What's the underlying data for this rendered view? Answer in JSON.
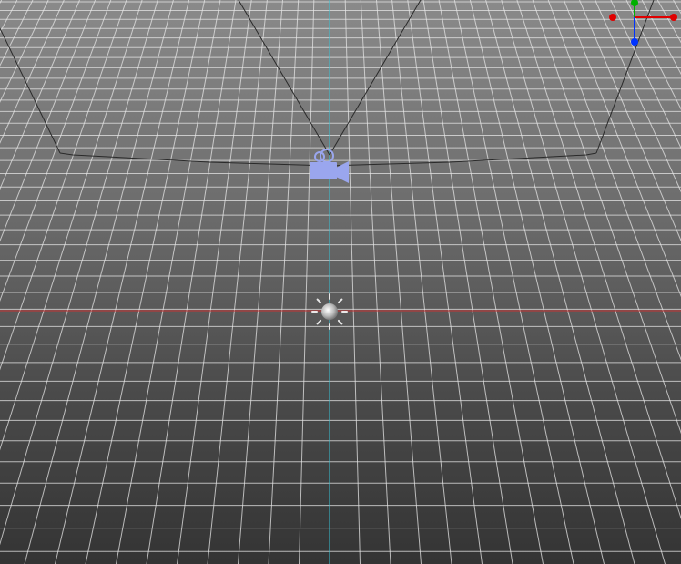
{
  "viewport": {
    "type": "3d-perspective-viewport",
    "background_top": "#8a8a8a",
    "background_bottom": "#343434",
    "grid_color": "#e6e6e6",
    "x_axis_color": "#c83232",
    "z_axis_color": "#36c3d6"
  },
  "objects": {
    "camera": {
      "icon": "video-camera-icon",
      "color": "#9aa6ee"
    },
    "light": {
      "icon": "sun-light-icon",
      "color": "#e8e8e8"
    },
    "frustum": {
      "color": "#2a2a2a"
    }
  },
  "gizmo": {
    "x_color": "#e00000",
    "y_color": "#00b000",
    "z_color": "#0033ff"
  }
}
